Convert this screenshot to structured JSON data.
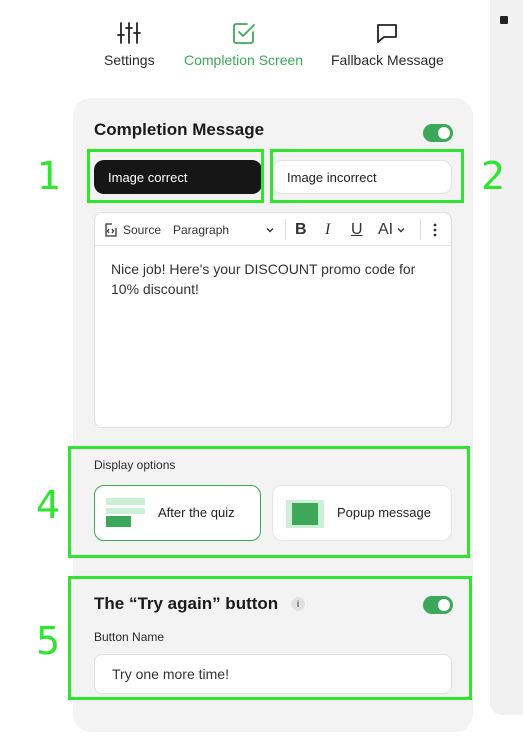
{
  "tabs": [
    {
      "label": "Settings",
      "icon": "sliders-icon",
      "active": false
    },
    {
      "label": "Completion Screen",
      "icon": "check-square-icon",
      "active": true
    },
    {
      "label": "Fallback Message",
      "icon": "message-square-icon",
      "active": false
    }
  ],
  "completion": {
    "title": "Completion Message",
    "enabled": true,
    "segments": {
      "correct": "Image correct",
      "incorrect": "Image incorrect",
      "selected": "correct"
    },
    "toolbar": {
      "source": "Source",
      "paragraph": "Paragraph",
      "bold": "B",
      "italic": "I",
      "underline": "U",
      "ai": "AI"
    },
    "message": "Nice job! Here's your DISCOUNT promo code for 10% discount!"
  },
  "display": {
    "label": "Display options",
    "options": [
      {
        "label": "After the quiz",
        "selected": true
      },
      {
        "label": "Popup message",
        "selected": false
      }
    ]
  },
  "try_again": {
    "title": "The “Try again” button",
    "info": "i",
    "enabled": true,
    "field_label": "Button Name",
    "value": "Try one more time!"
  },
  "annotations": [
    "1",
    "2",
    "4",
    "5"
  ],
  "colors": {
    "accent": "#3ea85a",
    "highlight": "#2fe52f",
    "dark_button": "#161616",
    "panel_bg": "#f3f3f3"
  }
}
